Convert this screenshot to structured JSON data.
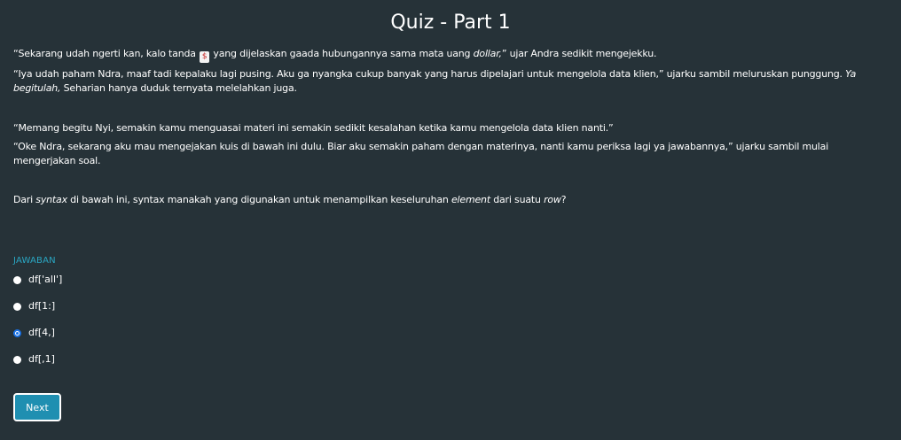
{
  "page": {
    "title": "Quiz - Part 1"
  },
  "story": {
    "p1": {
      "before": "“Sekarang udah ngerti kan, kalo tanda ",
      "icon_glyph": "$",
      "after": " yang dijelaskan gaada hubungannya sama mata uang ",
      "italic": "dollar,",
      "end": "” ujar Andra sedikit mengejekku."
    },
    "p2": {
      "text": "“Iya udah paham Ndra, maaf tadi kepalaku lagi pusing. Aku ga nyangka cukup banyak yang harus dipelajari untuk mengelola data klien,” ujarku sambil meluruskan punggung. ",
      "italic": "Ya begitulah,",
      "end": " Seharian hanya duduk ternyata melelahkan juga."
    },
    "p3": "“Memang begitu Nyi, semakin kamu menguasai materi ini semakin sedikit kesalahan ketika kamu mengelola data klien nanti.”",
    "p4": "“Oke Ndra, sekarang aku mau mengejakan kuis di bawah ini dulu. Biar aku semakin paham dengan materinya, nanti kamu periksa lagi ya jawabannya,” ujarku sambil mulai mengerjakan soal."
  },
  "question": {
    "t1": "Dari ",
    "i1": "syntax",
    "t2": " di bawah ini, syntax manakah yang digunakan untuk menampilkan keseluruhan ",
    "i2": "element",
    "t3": " dari suatu ",
    "i3": "row",
    "t4": "?"
  },
  "answers": {
    "label": "JAWABAN",
    "options": [
      {
        "label": "df['all']",
        "selected": false
      },
      {
        "label": "df[1:]",
        "selected": false
      },
      {
        "label": "df[4,]",
        "selected": true
      },
      {
        "label": "df[,1]",
        "selected": false
      }
    ]
  },
  "next_button": {
    "label": "Next"
  },
  "colors": {
    "background": "#263238",
    "accent": "#1f8fb1",
    "label": "#2aa6c2",
    "radio_selected": "#1a73e8"
  }
}
